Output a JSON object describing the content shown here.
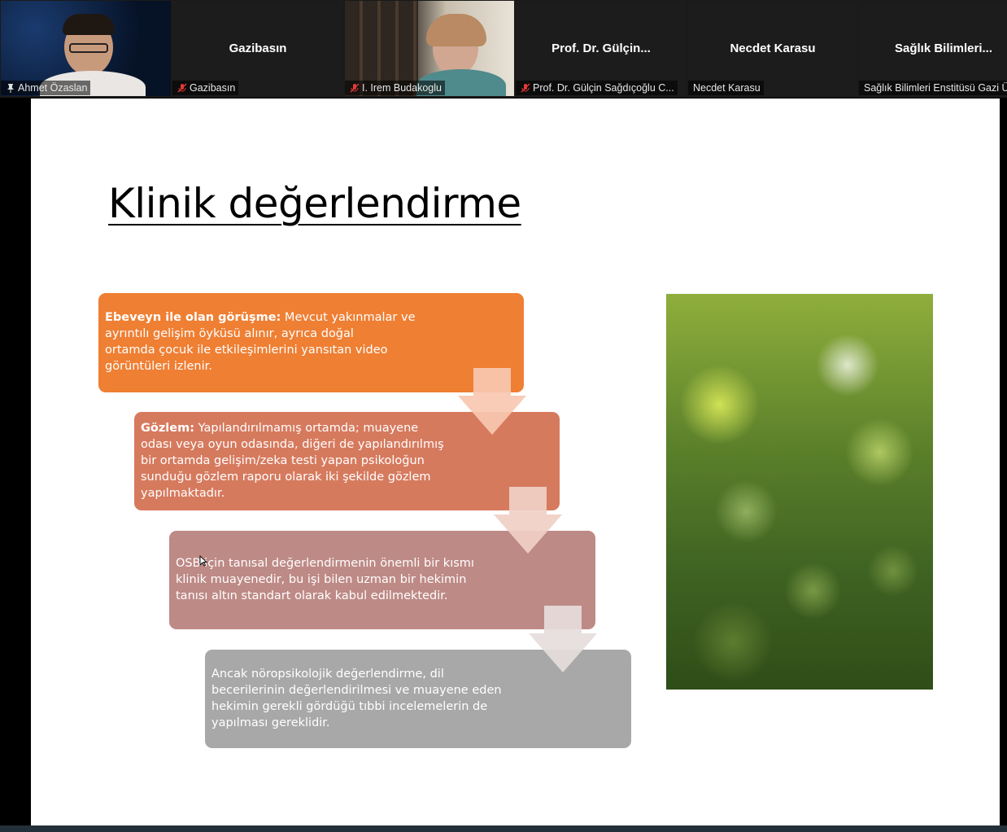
{
  "participants": [
    {
      "name": "Ahmet Özaslan",
      "display_name": "",
      "video": true,
      "muted": false,
      "pinned": true,
      "active_speaker": true
    },
    {
      "name": "Gazibasın",
      "display_name": "Gazibasın",
      "video": false,
      "muted": true
    },
    {
      "name": "I. Irem Budakoglu",
      "display_name": "",
      "video": true,
      "muted": true
    },
    {
      "name": "Prof. Dr. Gülçin Sağdıçoğlu C...",
      "display_name": "Prof. Dr. Gülçin...",
      "video": false,
      "muted": true
    },
    {
      "name": "Necdet Karasu",
      "display_name": "Necdet Karasu",
      "video": false,
      "muted": false
    },
    {
      "name": "Sağlık Bilimleri Enstitüsü Gazi Ü",
      "display_name": "Sağlık Bilimleri...",
      "video": false,
      "muted": false
    }
  ],
  "slide": {
    "title": "Klinik değerlendirme",
    "steps": [
      {
        "bold": "Ebeveyn ile olan görüşme:",
        "lines": [
          " Mevcut yakınmalar ve",
          "ayrıntılı gelişim öyküsü alınır, ayrıca doğal",
          "ortamda çocuk ile etkileşimlerini yansıtan video",
          "görüntüleri izlenir."
        ],
        "color": "#ef7f33"
      },
      {
        "bold": "Gözlem:",
        "lines": [
          " Yapılandırılmamış ortamda; muayene",
          "odası veya oyun odasında, diğeri de yapılandırılmış",
          "bir ortamda gelişim/zeka testi yapan psikoloğun",
          "sunduğu gözlem raporu olarak iki şekilde gözlem",
          "yapılmaktadır."
        ],
        "color": "#d67a5e"
      },
      {
        "bold": "",
        "lines": [
          "OSB için tanısal değerlendirmenin önemli bir kısmı",
          "klinik muayenedir, bu işi bilen uzman bir hekimin",
          "tanısı altın standart olarak kabul edilmektedir."
        ],
        "color": "#be8a86"
      },
      {
        "bold": "",
        "lines": [
          "Ancak nöropsikolojik değerlendirme, dil",
          "becerilerinin değerlendirilmesi ve muayene eden",
          "hekimin gerekli gördüğü tıbbi incelemelerin de",
          "yapılması gereklidir."
        ],
        "color": "#a8a8a8"
      }
    ]
  },
  "icons": {
    "pin": "pin-icon",
    "mic_muted": "mic-muted-icon",
    "arrow": "down-arrow-icon",
    "photo": "bokeh-photo"
  }
}
